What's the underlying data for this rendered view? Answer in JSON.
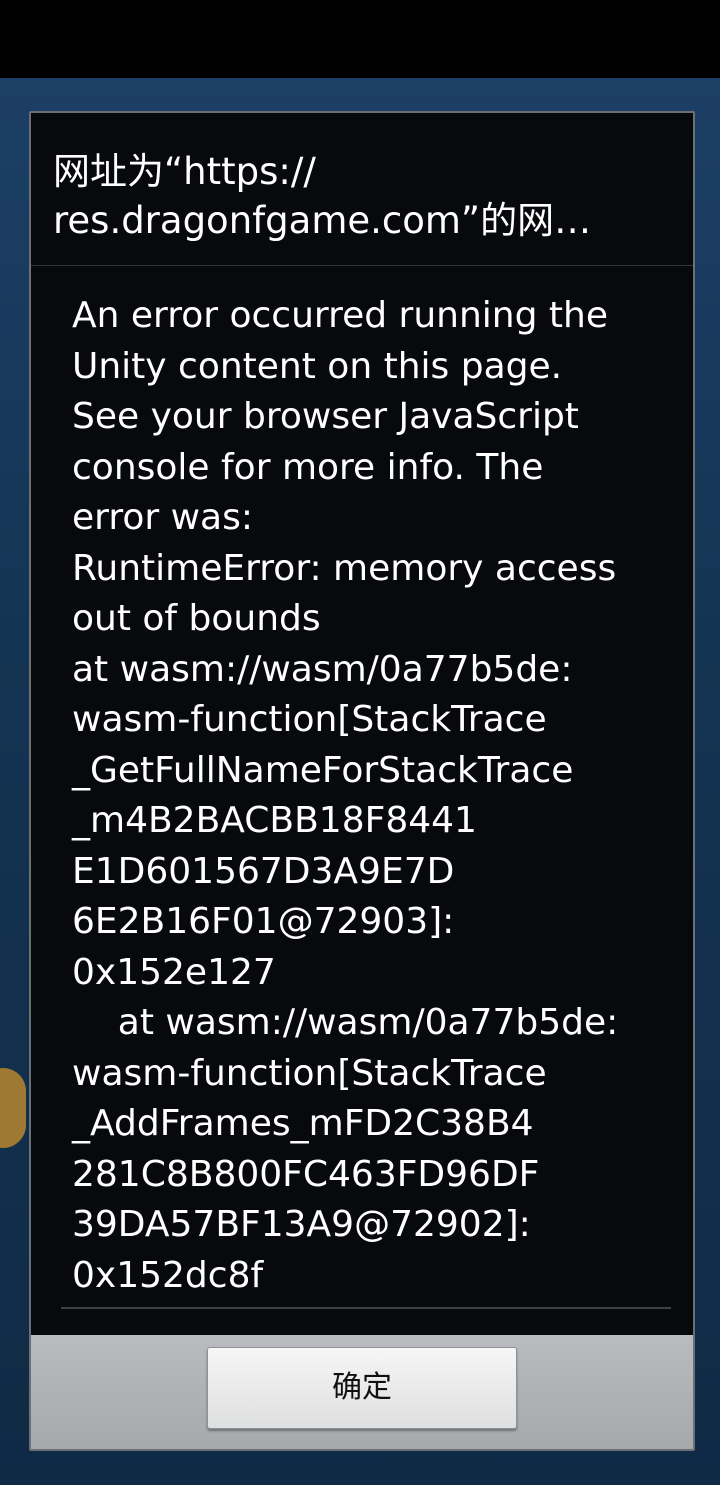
{
  "dialog": {
    "title": "网址为“https://\nres.dragonfgame.com”的网…",
    "message": "An error occurred running the\nUnity content on this page.\nSee your browser JavaScript\nconsole for more info. The\nerror was:\nRuntimeError: memory access\nout of bounds\nat wasm://wasm/0a77b5de:\nwasm-function[StackTrace\n_GetFullNameForStackTrace\n_m4B2BACBB18F8441\nE1D601567D3A9E7D\n6E2B16F01@72903]:\n0x152e127\n    at wasm://wasm/0a77b5de:\nwasm-function[StackTrace\n_AddFrames_mFD2C38B4\n281C8B800FC463FD96DF\n39DA57BF13A9@72902]:\n0x152dc8f",
    "ok_label": "确定"
  },
  "colors": {
    "dialog_background": "#07090c",
    "button_bar": "#b9bbbe",
    "game_background": "#143453"
  }
}
